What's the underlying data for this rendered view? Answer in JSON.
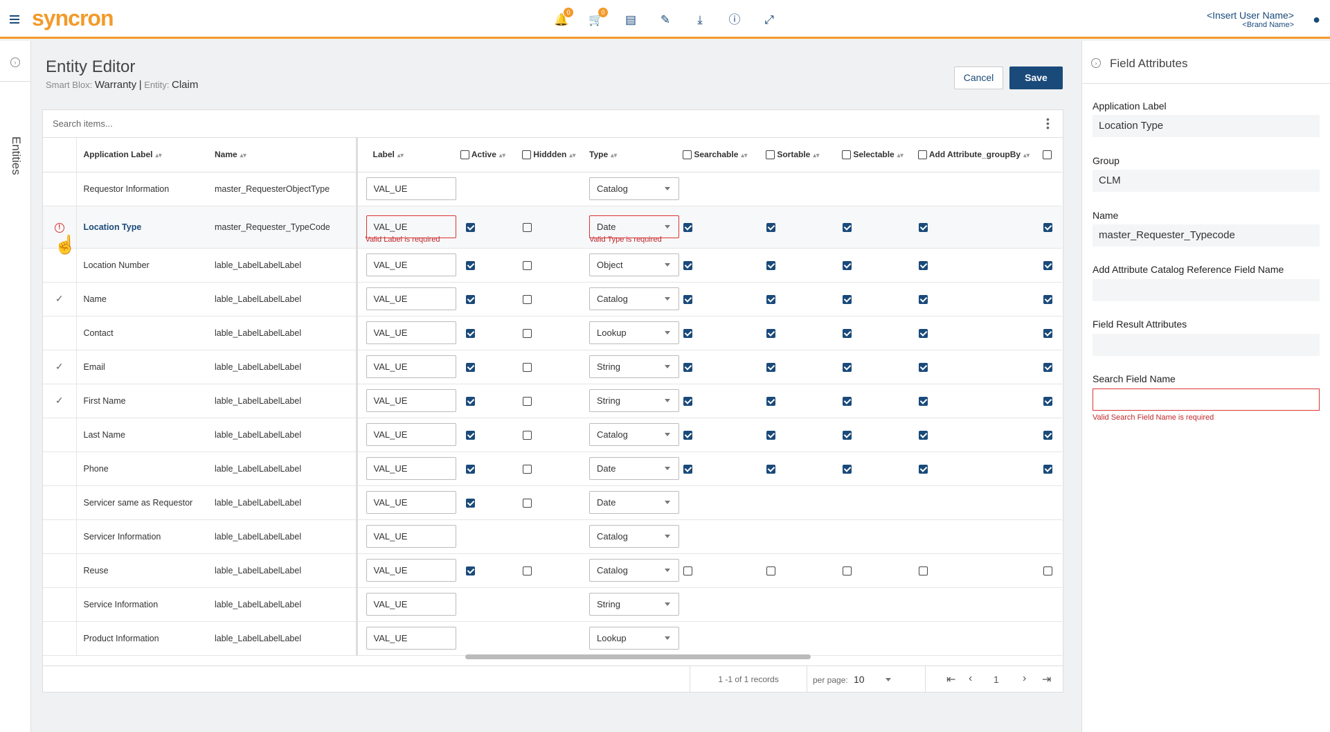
{
  "app": {
    "logo": "syncron",
    "cart_badge": "0",
    "bell_badge": "0"
  },
  "user": {
    "name": "<Insert User Name>",
    "brand": "<Brand Name>"
  },
  "sidebar": {
    "label": "Entities"
  },
  "page": {
    "title": "Entity Editor",
    "smartblox_label": "Smart Blox:",
    "smartblox_value": "Warranty",
    "entity_label": "Entity:",
    "entity_value": "Claim",
    "cancel": "Cancel",
    "save": "Save"
  },
  "search": {
    "placeholder": "Search items..."
  },
  "columns": {
    "app_label": "Application Label",
    "name": "Name",
    "label": "Label",
    "active": "Active",
    "hidden": "Hiddden",
    "type": "Type",
    "searchable": "Searchable",
    "sortable": "Sortable",
    "selectable": "Selectable",
    "groupby": "Add Attribute_groupBy"
  },
  "rows": [
    {
      "status": "",
      "app_label": "Requestor Information",
      "name": "master_RequesterObjectType",
      "label": "VAL_UE",
      "type": "Catalog",
      "checks": null
    },
    {
      "status": "error",
      "app_label": "Location Type",
      "name": "master_Requester_TypeCode",
      "label": "VAL_UE",
      "type": "Date",
      "checks": [
        true,
        false,
        true,
        true,
        true,
        true,
        true
      ],
      "label_error": "Valid Label is required",
      "type_error": "Valid Type is required"
    },
    {
      "status": "",
      "app_label": "Location Number",
      "name": "lable_LabelLabelLabel",
      "label": "VAL_UE",
      "type": "Object",
      "checks": [
        true,
        false,
        true,
        true,
        true,
        true,
        true
      ]
    },
    {
      "status": "ok",
      "app_label": "Name",
      "name": "lable_LabelLabelLabel",
      "label": "VAL_UE",
      "type": "Catalog",
      "checks": [
        true,
        false,
        true,
        true,
        true,
        true,
        true
      ]
    },
    {
      "status": "",
      "app_label": "Contact",
      "name": "lable_LabelLabelLabel",
      "label": "VAL_UE",
      "type": "Lookup",
      "checks": [
        true,
        false,
        true,
        true,
        true,
        true,
        true
      ]
    },
    {
      "status": "ok",
      "app_label": "Email",
      "name": "lable_LabelLabelLabel",
      "label": "VAL_UE",
      "type": "String",
      "checks": [
        true,
        false,
        true,
        true,
        true,
        true,
        true
      ]
    },
    {
      "status": "ok",
      "app_label": "First Name",
      "name": "lable_LabelLabelLabel",
      "label": "VAL_UE",
      "type": "String",
      "checks": [
        true,
        false,
        true,
        true,
        true,
        true,
        true
      ]
    },
    {
      "status": "",
      "app_label": "Last Name",
      "name": "lable_LabelLabelLabel",
      "label": "VAL_UE",
      "type": "Catalog",
      "checks": [
        true,
        false,
        true,
        true,
        true,
        true,
        true
      ]
    },
    {
      "status": "",
      "app_label": "Phone",
      "name": "lable_LabelLabelLabel",
      "label": "VAL_UE",
      "type": "Date",
      "checks": [
        true,
        false,
        true,
        true,
        true,
        true,
        true
      ]
    },
    {
      "status": "",
      "app_label": "Servicer same as Requestor",
      "name": "lable_LabelLabelLabel",
      "label": "VAL_UE",
      "type": "Date",
      "checks": [
        true,
        false,
        null,
        null,
        null,
        null,
        null
      ]
    },
    {
      "status": "",
      "app_label": "Servicer Information",
      "name": "lable_LabelLabelLabel",
      "label": "VAL_UE",
      "type": "Catalog",
      "checks": null
    },
    {
      "status": "",
      "app_label": "Reuse",
      "name": "lable_LabelLabelLabel",
      "label": "VAL_UE",
      "type": "Catalog",
      "checks": [
        true,
        false,
        false,
        false,
        false,
        false,
        false
      ]
    },
    {
      "status": "",
      "app_label": "Service Information",
      "name": "lable_LabelLabelLabel",
      "label": "VAL_UE",
      "type": "String",
      "checks": null
    },
    {
      "status": "",
      "app_label": "Product Information",
      "name": "lable_LabelLabelLabel",
      "label": "VAL_UE",
      "type": "Lookup",
      "checks": null
    }
  ],
  "pagination": {
    "records": "1 -1 of 1 records",
    "per_page_label": "per page:",
    "per_page": "10",
    "page": "1"
  },
  "panel": {
    "title": "Field Attributes",
    "fields": [
      {
        "label": "Application Label",
        "value": "Location Type"
      },
      {
        "label": "Group",
        "value": "CLM"
      },
      {
        "label": "Name",
        "value": "master_Requester_Typecode"
      },
      {
        "label": "Add Attribute Catalog Reference Field Name",
        "value": ""
      },
      {
        "label": "Field Result Attributes",
        "value": ""
      },
      {
        "label": "Search Field Name",
        "value": "",
        "error": "Valid Search Field Name is required"
      }
    ]
  },
  "colors": {
    "brand": "#f39a2b",
    "primary": "#1a4a7a",
    "error": "#c0282d"
  }
}
